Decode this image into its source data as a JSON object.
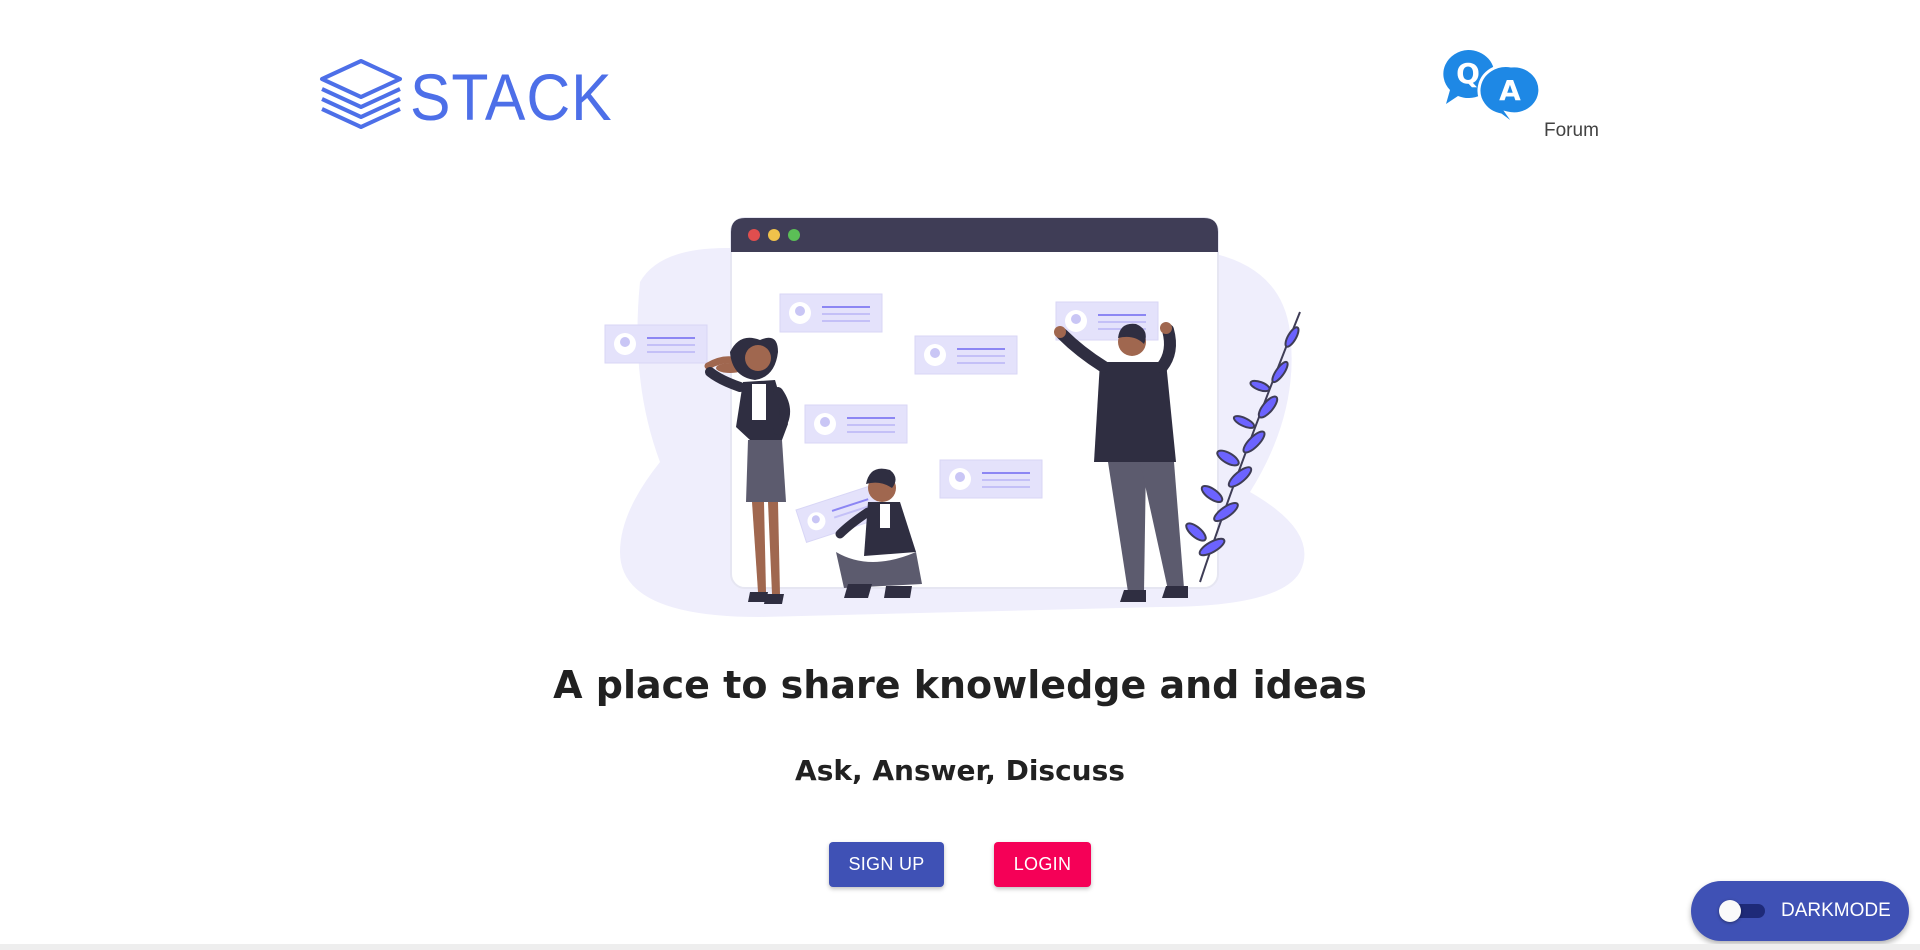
{
  "header": {
    "logo_text": "STACK",
    "qa_logo": {
      "q_letter": "Q",
      "a_letter": "A",
      "caption": "Forum"
    }
  },
  "hero": {
    "illustration": "people-sharing-knowledge-illustration",
    "headline": "A place to share knowledge and ideas",
    "subheadline": "Ask, Answer, Discuss"
  },
  "actions": {
    "signup_label": "SIGN UP",
    "login_label": "LOGIN"
  },
  "darkmode": {
    "label": "DARKMODE",
    "enabled": false
  },
  "colors": {
    "brand_blue": "#4d6fe8",
    "primary": "#3f51b5",
    "secondary": "#f50057",
    "qa_blue": "#1e88e5",
    "illustration_purple": "#6c63ff"
  }
}
